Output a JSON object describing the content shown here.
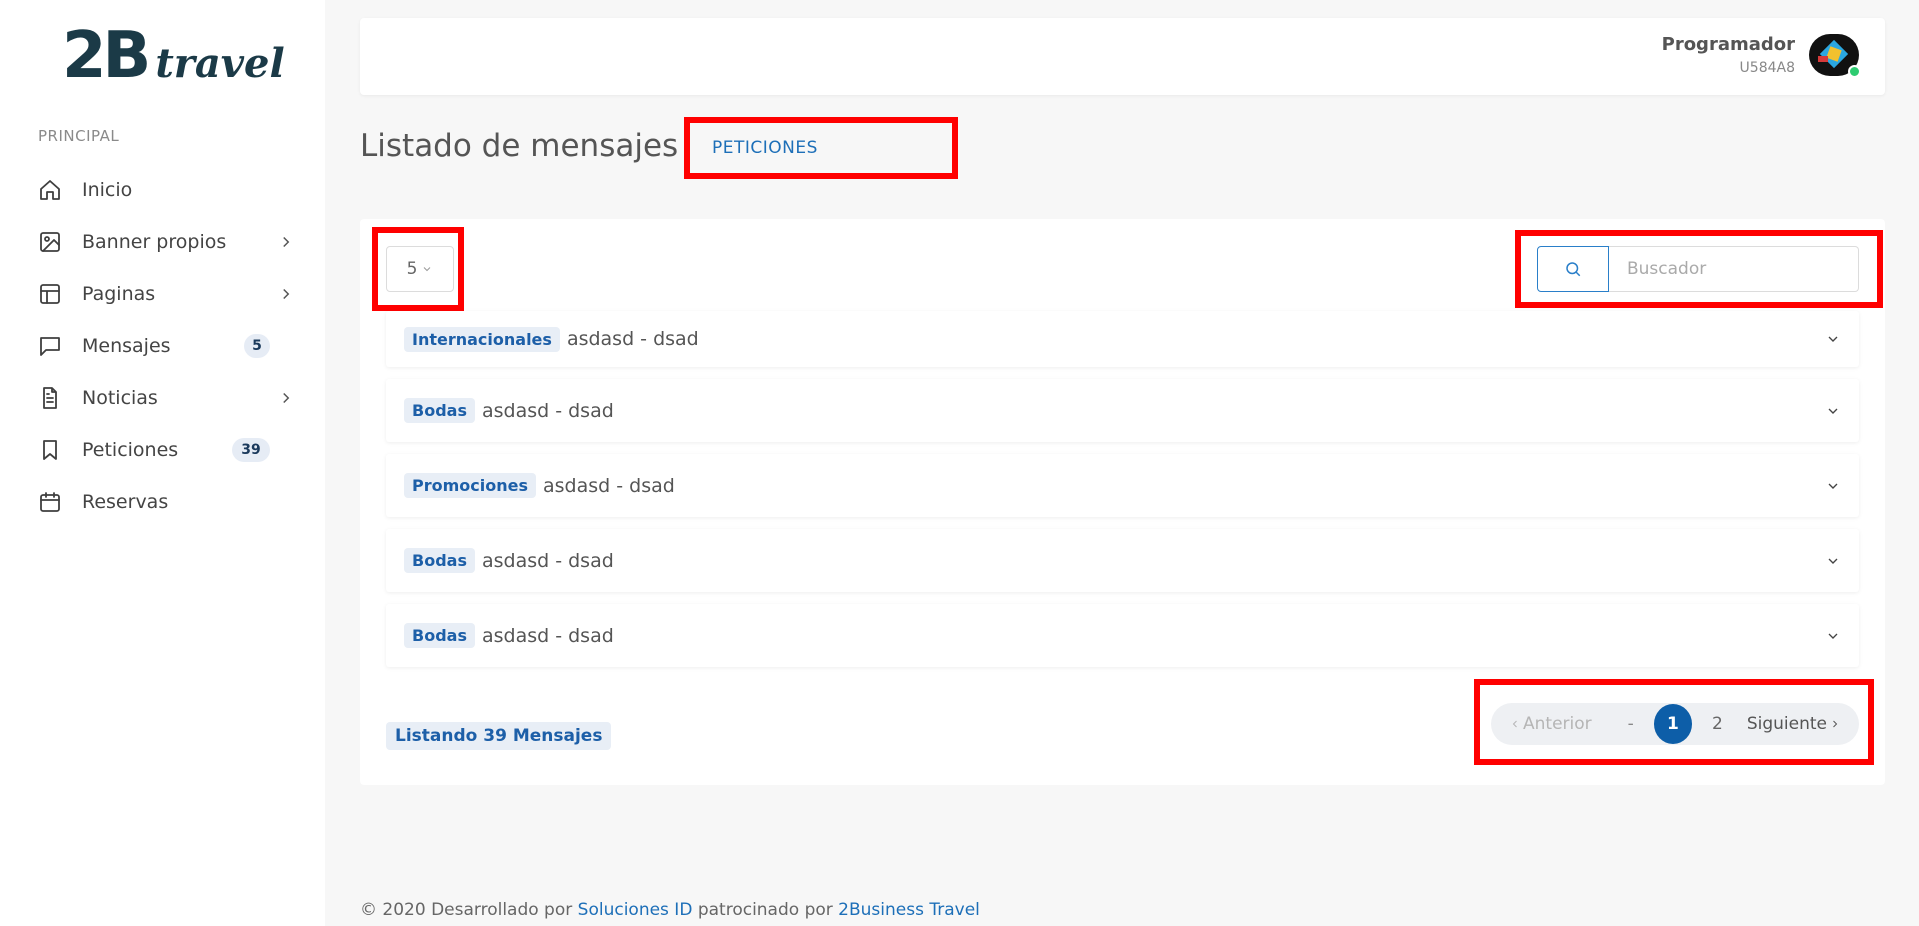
{
  "logo": {
    "main": "2B",
    "sub": "travel"
  },
  "sidebar": {
    "section": "PRINCIPAL",
    "items": [
      {
        "label": "Inicio",
        "icon": "home-icon"
      },
      {
        "label": "Banner propios",
        "icon": "image-icon",
        "has_submenu": true
      },
      {
        "label": "Paginas",
        "icon": "layout-icon",
        "has_submenu": true
      },
      {
        "label": "Mensajes",
        "icon": "message-icon",
        "badge": "5"
      },
      {
        "label": "Noticias",
        "icon": "file-text-icon",
        "has_submenu": true
      },
      {
        "label": "Peticiones",
        "icon": "bookmark-icon",
        "badge": "39"
      },
      {
        "label": "Reservas",
        "icon": "calendar-icon"
      }
    ]
  },
  "header": {
    "user_name": "Programador",
    "user_id": "U584A8"
  },
  "page": {
    "title": "Listado de mensajes",
    "tag": "PETICIONES"
  },
  "controls": {
    "per_page": "5",
    "search_placeholder": "Buscador"
  },
  "messages": [
    {
      "category": "Internacionales",
      "text": "asdasd - dsad"
    },
    {
      "category": "Bodas",
      "text": "asdasd - dsad"
    },
    {
      "category": "Promociones",
      "text": "asdasd - dsad"
    },
    {
      "category": "Bodas",
      "text": "asdasd - dsad"
    },
    {
      "category": "Bodas",
      "text": "asdasd - dsad"
    }
  ],
  "listing_count": "Listando 39 Mensajes",
  "pagination": {
    "prev": "Anterior",
    "dash": "-",
    "current": "1",
    "page2": "2",
    "next": "Siguiente"
  },
  "footer": {
    "prefix": "© 2020 Desarrollado por ",
    "link1": "Soluciones ID",
    "middle": " patrocinado por ",
    "link2": "2Business Travel"
  },
  "colors": {
    "accent": "#0d5ea8",
    "highlight": "#ff0000",
    "link": "#1d6fb8"
  }
}
